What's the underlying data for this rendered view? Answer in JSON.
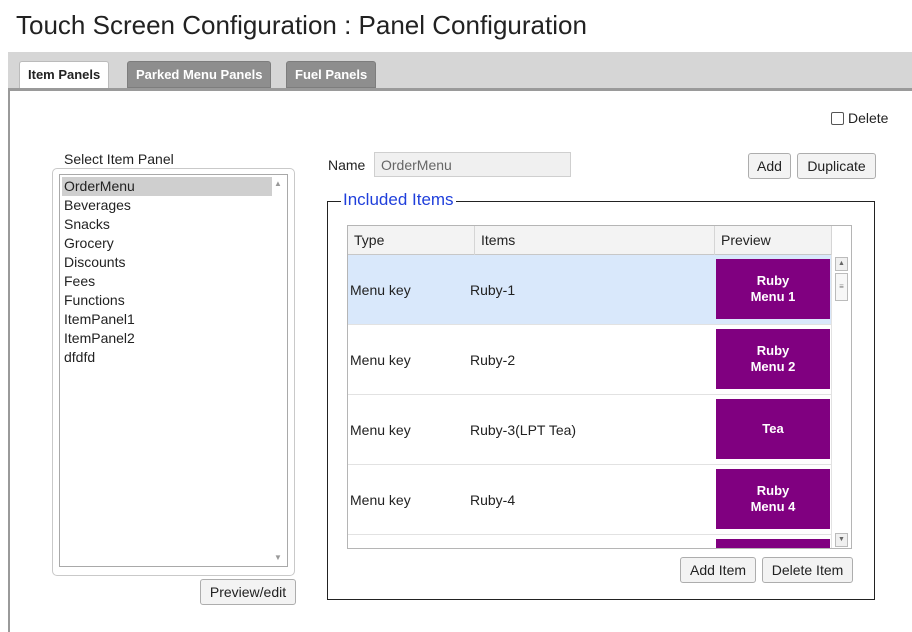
{
  "page": {
    "title": "Touch Screen Configuration : Panel Configuration"
  },
  "tabs": [
    {
      "label": "Item Panels",
      "active": true
    },
    {
      "label": "Parked Menu Panels",
      "active": false
    },
    {
      "label": "Fuel Panels",
      "active": false
    }
  ],
  "delete_checkbox": {
    "label": "Delete",
    "checked": false
  },
  "item_panel_list": {
    "legend": "Select Item Panel",
    "items": [
      "OrderMenu",
      "Beverages",
      "Snacks",
      "Grocery",
      "Discounts",
      "Fees",
      "Functions",
      "ItemPanel1",
      "ItemPanel2",
      "dfdfd"
    ],
    "selected": "OrderMenu"
  },
  "preview_edit_button": "Preview/edit",
  "name_field": {
    "label": "Name",
    "value": "OrderMenu"
  },
  "add_button": "Add",
  "duplicate_button": "Duplicate",
  "included_items": {
    "legend": "Included Items",
    "columns": [
      "Type",
      "Items",
      "Preview"
    ],
    "rows": [
      {
        "type": "Menu key",
        "item": "Ruby-1",
        "preview": "Ruby\nMenu 1",
        "selected": true
      },
      {
        "type": "Menu key",
        "item": "Ruby-2",
        "preview": "Ruby\nMenu 2",
        "selected": false
      },
      {
        "type": "Menu key",
        "item": "Ruby-3(LPT Tea)",
        "preview": "Tea",
        "selected": false
      },
      {
        "type": "Menu key",
        "item": "Ruby-4",
        "preview": "Ruby\nMenu 4",
        "selected": false
      }
    ],
    "preview_color": "#800080"
  },
  "add_item_button": "Add Item",
  "delete_item_button": "Delete Item"
}
